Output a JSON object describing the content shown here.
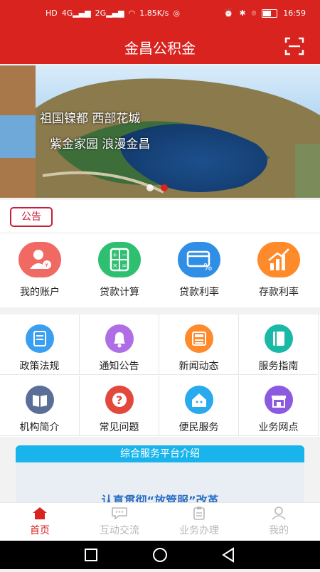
{
  "status_bar": {
    "net": "HD",
    "sig1": "4G",
    "sig2": "2G",
    "speed": "1.85K/s",
    "time": "16:59",
    "battery_percent": 0.6
  },
  "header": {
    "title": "金昌公积金"
  },
  "banner": {
    "line1": "祖国镍都  西部花城",
    "line2": "紫金家园  浪漫金昌",
    "active_slide": 1
  },
  "notice": {
    "tag": "公告"
  },
  "quick_actions": [
    {
      "label": "我的账户",
      "icon": "account-icon",
      "color": "#f06a63"
    },
    {
      "label": "贷款计算",
      "icon": "calculator-icon",
      "color": "#2fbf71"
    },
    {
      "label": "贷款利率",
      "icon": "loan-rate-icon",
      "color": "#2f8fe6"
    },
    {
      "label": "存款利率",
      "icon": "deposit-rate-icon",
      "color": "#ff8a2b"
    }
  ],
  "services": [
    {
      "label": "政策法规",
      "icon": "policy-icon",
      "color": "#3a9ff0"
    },
    {
      "label": "通知公告",
      "icon": "bell-icon",
      "color": "#b06ee6"
    },
    {
      "label": "新闻动态",
      "icon": "news-icon",
      "color": "#ff8a2b"
    },
    {
      "label": "服务指南",
      "icon": "guide-icon",
      "color": "#19b9a6"
    },
    {
      "label": "机构简介",
      "icon": "book-icon",
      "color": "#5a6f98"
    },
    {
      "label": "常见问题",
      "icon": "question-icon",
      "color": "#e2483c"
    },
    {
      "label": "便民服务",
      "icon": "house-icon",
      "color": "#29a9ee"
    },
    {
      "label": "业务网点",
      "icon": "store-icon",
      "color": "#8c5ae0"
    }
  ],
  "intro": {
    "header": "综合服务平台介绍",
    "headline": "认真贯彻“放管服”改革"
  },
  "tabs": [
    {
      "label": "首页",
      "icon": "home-icon",
      "active": true
    },
    {
      "label": "互动交流",
      "icon": "chat-icon",
      "active": false
    },
    {
      "label": "业务办理",
      "icon": "clipboard-icon",
      "active": false
    },
    {
      "label": "我的",
      "icon": "user-icon",
      "active": false
    }
  ],
  "colors": {
    "brand_red": "#d8231f",
    "intro_blue": "#19b4ec"
  }
}
